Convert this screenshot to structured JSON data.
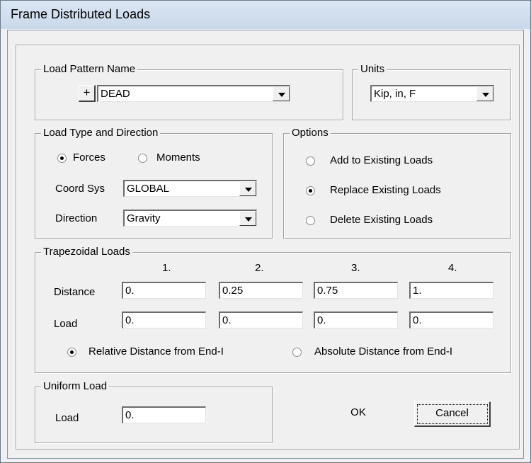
{
  "window": {
    "title": "Frame Distributed Loads"
  },
  "load_pattern": {
    "group_label": "Load Pattern Name",
    "add_label": "+",
    "selected": "DEAD"
  },
  "units": {
    "group_label": "Units",
    "selected": "Kip, in, F"
  },
  "load_type": {
    "group_label": "Load Type and Direction",
    "forces_label": "Forces",
    "moments_label": "Moments",
    "selected": "Forces",
    "coord_sys_label": "Coord Sys",
    "coord_sys_value": "GLOBAL",
    "direction_label": "Direction",
    "direction_value": "Gravity"
  },
  "options": {
    "group_label": "Options",
    "items": [
      "Add to Existing Loads",
      "Replace Existing Loads",
      "Delete Existing Loads"
    ],
    "selected": "Replace Existing Loads"
  },
  "trapezoidal": {
    "group_label": "Trapezoidal Loads",
    "columns": [
      "1.",
      "2.",
      "3.",
      "4."
    ],
    "distance_label": "Distance",
    "distances": [
      "0.",
      "0.25",
      "0.75",
      "1."
    ],
    "load_label": "Load",
    "loads": [
      "0.",
      "0.",
      "0.",
      "0."
    ],
    "relative_label": "Relative Distance from End-I",
    "absolute_label": "Absolute Distance from End-I",
    "selected": "Relative Distance from End-I"
  },
  "uniform": {
    "group_label": "Uniform Load",
    "load_label": "Load",
    "load_value": "0."
  },
  "buttons": {
    "ok": "OK",
    "cancel": "Cancel"
  }
}
